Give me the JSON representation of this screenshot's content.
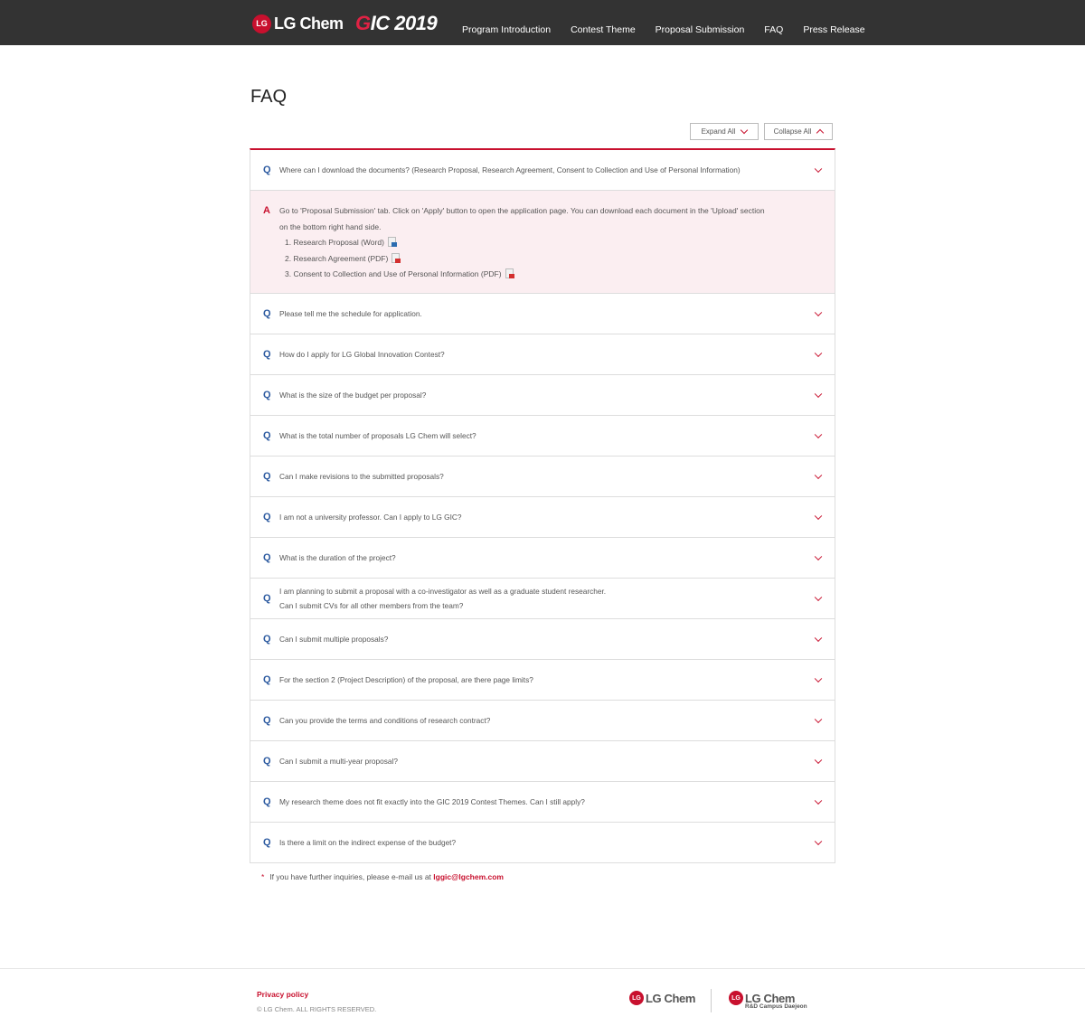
{
  "header": {
    "logo_lg_mark": "LG",
    "logo_lg_text": "LG Chem",
    "logo_gic_g": "G",
    "logo_gic_rest": "IC 2019",
    "nav": [
      "Program Introduction",
      "Contest Theme",
      "Proposal Submission",
      "FAQ",
      "Press Release"
    ]
  },
  "page": {
    "title": "FAQ",
    "expand_all": "Expand All",
    "collapse_all": "Collapse All"
  },
  "faq": {
    "q_mark": "Q",
    "a_mark": "A",
    "items": [
      {
        "q": "Where can I download the documents? (Research Proposal, Research Agreement, Consent to Collection and Use of Personal Information)"
      },
      {
        "q": "Please tell me the schedule for application."
      },
      {
        "q": "How do I apply for LG Global Innovation Contest?"
      },
      {
        "q": "What is the size of the budget per proposal?"
      },
      {
        "q": "What is the total number of proposals LG Chem will select?"
      },
      {
        "q": "Can I make revisions to the submitted proposals?"
      },
      {
        "q": "I am not a university professor. Can I apply to LG GIC?"
      },
      {
        "q": "What is the duration of the project?"
      },
      {
        "q": "I am planning to submit a proposal with a co-investigator as well as a graduate student researcher.",
        "q2": "Can I submit CVs for all other members from the team?"
      },
      {
        "q": "Can I submit multiple proposals?"
      },
      {
        "q": "For the section 2 (Project Description) of the proposal, are there page limits?"
      },
      {
        "q": "Can you provide the terms and conditions of research contract?"
      },
      {
        "q": "Can I submit a multi-year proposal?"
      },
      {
        "q": "My research theme does not fit exactly into the GIC 2019 Contest Themes. Can I still apply?"
      },
      {
        "q": "Is there a limit on the indirect expense of the budget?"
      }
    ],
    "answer": {
      "line1": "Go to 'Proposal Submission' tab. Click on 'Apply' button to open the application page. You can download each document in the 'Upload' section",
      "line2": "on the bottom right hand side.",
      "docs": [
        {
          "label": "1. Research Proposal (Word)",
          "icon": "word-icon"
        },
        {
          "label": "2. Research Agreement (PDF)",
          "icon": "pdf-icon"
        },
        {
          "label": "3. Consent to Collection and Use of Personal Information (PDF)",
          "icon": "pdf-icon"
        }
      ]
    }
  },
  "note": {
    "star": "*",
    "text": "If you have further inquiries, please e-mail us at ",
    "email": "lggic@lgchem.com"
  },
  "footer": {
    "privacy": "Privacy policy",
    "copyright": "© LG Chem. ALL RIGHTS RESERVED.",
    "logo_mark": "LG",
    "logo_text": "LG Chem",
    "logo2_text": "LG Chem",
    "logo2_sub": "R&D Campus Daejeon"
  },
  "colors": {
    "accent": "#c8102e",
    "header_bg": "#333333",
    "q_mark": "#2c5aa0",
    "answer_bg": "#fbeef1"
  }
}
